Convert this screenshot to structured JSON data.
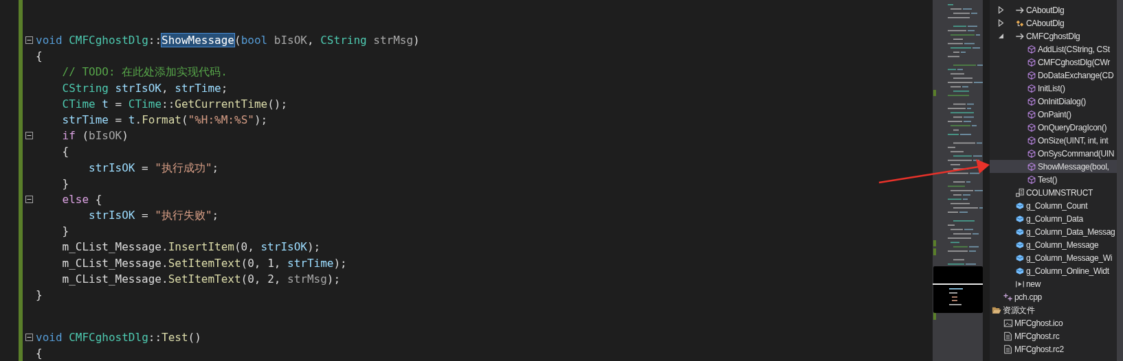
{
  "editor": {
    "lines": [
      {
        "kind": "top",
        "fold": true,
        "tokens": [
          {
            "kind": "keyword",
            "text": "void "
          },
          {
            "kind": "type",
            "text": "CMFCghostDlg"
          },
          {
            "kind": "plain",
            "text": "::"
          },
          {
            "kind": "selection",
            "text": "ShowMessage"
          },
          {
            "kind": "plain",
            "text": "("
          },
          {
            "kind": "keyword",
            "text": "bool"
          },
          {
            "kind": "param",
            "text": " bIsOK"
          },
          {
            "kind": "plain",
            "text": ", "
          },
          {
            "kind": "type",
            "text": "CString"
          },
          {
            "kind": "param",
            "text": " strMsg"
          },
          {
            "kind": "plain",
            "text": ")"
          }
        ]
      },
      {
        "kind": "top",
        "fold": false,
        "tokens": [
          {
            "kind": "plain",
            "text": "{"
          }
        ]
      },
      {
        "kind": "body",
        "fold": false,
        "tokens": [
          {
            "kind": "comment",
            "text": "// TODO: 在此处添加实现代码."
          }
        ]
      },
      {
        "kind": "body",
        "fold": false,
        "tokens": [
          {
            "kind": "type",
            "text": "CString "
          },
          {
            "kind": "variable",
            "text": "strIsOK"
          },
          {
            "kind": "plain",
            "text": ", "
          },
          {
            "kind": "variable",
            "text": "strTime"
          },
          {
            "kind": "plain",
            "text": ";"
          }
        ]
      },
      {
        "kind": "body",
        "fold": false,
        "tokens": [
          {
            "kind": "type",
            "text": "CTime "
          },
          {
            "kind": "variable",
            "text": "t"
          },
          {
            "kind": "plain",
            "text": " = "
          },
          {
            "kind": "type",
            "text": "CTime"
          },
          {
            "kind": "plain",
            "text": "::"
          },
          {
            "kind": "function",
            "text": "GetCurrentTime"
          },
          {
            "kind": "plain",
            "text": "();"
          }
        ]
      },
      {
        "kind": "body",
        "fold": false,
        "tokens": [
          {
            "kind": "variable",
            "text": "strTime"
          },
          {
            "kind": "plain",
            "text": " = "
          },
          {
            "kind": "variable",
            "text": "t"
          },
          {
            "kind": "plain",
            "text": "."
          },
          {
            "kind": "function",
            "text": "Format"
          },
          {
            "kind": "plain",
            "text": "("
          },
          {
            "kind": "string",
            "text": "\"%H:%M:%S\""
          },
          {
            "kind": "plain",
            "text": ");"
          }
        ]
      },
      {
        "kind": "body",
        "fold": true,
        "tokens": [
          {
            "kind": "control",
            "text": "if"
          },
          {
            "kind": "plain",
            "text": " ("
          },
          {
            "kind": "param",
            "text": "bIsOK"
          },
          {
            "kind": "plain",
            "text": ")"
          }
        ]
      },
      {
        "kind": "body",
        "fold": false,
        "tokens": [
          {
            "kind": "plain",
            "text": "{"
          }
        ]
      },
      {
        "kind": "inner",
        "fold": false,
        "tokens": [
          {
            "kind": "variable",
            "text": "strIsOK"
          },
          {
            "kind": "plain",
            "text": " = "
          },
          {
            "kind": "string",
            "text": "\"执行成功\""
          },
          {
            "kind": "plain",
            "text": ";"
          }
        ]
      },
      {
        "kind": "body",
        "fold": false,
        "tokens": [
          {
            "kind": "plain",
            "text": "}"
          }
        ]
      },
      {
        "kind": "body",
        "fold": true,
        "tokens": [
          {
            "kind": "control",
            "text": "else"
          },
          {
            "kind": "plain",
            "text": " {"
          }
        ]
      },
      {
        "kind": "inner",
        "fold": false,
        "tokens": [
          {
            "kind": "variable",
            "text": "strIsOK"
          },
          {
            "kind": "plain",
            "text": " = "
          },
          {
            "kind": "string",
            "text": "\"执行失败\""
          },
          {
            "kind": "plain",
            "text": ";"
          }
        ]
      },
      {
        "kind": "body",
        "fold": false,
        "tokens": [
          {
            "kind": "plain",
            "text": "}"
          }
        ]
      },
      {
        "kind": "body",
        "fold": false,
        "tokens": [
          {
            "kind": "plain",
            "text": "m_CList_Message."
          },
          {
            "kind": "function",
            "text": "InsertItem"
          },
          {
            "kind": "plain",
            "text": "(0, "
          },
          {
            "kind": "variable",
            "text": "strIsOK"
          },
          {
            "kind": "plain",
            "text": ");"
          }
        ]
      },
      {
        "kind": "body",
        "fold": false,
        "tokens": [
          {
            "kind": "plain",
            "text": "m_CList_Message."
          },
          {
            "kind": "function",
            "text": "SetItemText"
          },
          {
            "kind": "plain",
            "text": "(0, 1, "
          },
          {
            "kind": "variable",
            "text": "strTime"
          },
          {
            "kind": "plain",
            "text": ");"
          }
        ]
      },
      {
        "kind": "body",
        "fold": false,
        "tokens": [
          {
            "kind": "plain",
            "text": "m_CList_Message."
          },
          {
            "kind": "function",
            "text": "SetItemText"
          },
          {
            "kind": "plain",
            "text": "(0, 2, "
          },
          {
            "kind": "param",
            "text": "strMsg"
          },
          {
            "kind": "plain",
            "text": ");"
          }
        ]
      },
      {
        "kind": "top",
        "fold": false,
        "tokens": [
          {
            "kind": "plain",
            "text": "}"
          }
        ]
      },
      {
        "fold": false
      },
      {
        "fold": false
      },
      {
        "kind": "top",
        "fold": true,
        "tokens": [
          {
            "kind": "keyword",
            "text": "void "
          },
          {
            "kind": "type",
            "text": "CMFCghostDlg"
          },
          {
            "kind": "plain",
            "text": "::"
          },
          {
            "kind": "function",
            "text": "Test"
          },
          {
            "kind": "plain",
            "text": "()"
          }
        ]
      },
      {
        "kind": "top",
        "fold": false,
        "tokens": [
          {
            "kind": "plain",
            "text": "{"
          }
        ]
      }
    ]
  },
  "solution_explorer": {
    "class_rows": [
      {
        "label": "CAboutDlg",
        "kind": "class-ref",
        "selected": false,
        "expanded": false
      },
      {
        "label": "CAboutDlg",
        "kind": "class",
        "selected": false,
        "expanded": false
      },
      {
        "label": "CMFCghostDlg",
        "kind": "class-ref",
        "selected": false,
        "expanded": true,
        "children": [
          {
            "label": "AddList(CString, CSt",
            "kind": "method",
            "selected": false
          },
          {
            "label": "CMFCghostDlg(CWr",
            "kind": "method",
            "selected": false
          },
          {
            "label": "DoDataExchange(CD",
            "kind": "method",
            "selected": false
          },
          {
            "label": "InitList()",
            "kind": "method",
            "selected": false
          },
          {
            "label": "OnInitDialog()",
            "kind": "method",
            "selected": false
          },
          {
            "label": "OnPaint()",
            "kind": "method",
            "selected": false
          },
          {
            "label": "OnQueryDragIcon()",
            "kind": "method",
            "selected": false
          },
          {
            "label": "OnSize(UINT, int, int",
            "kind": "method",
            "selected": false
          },
          {
            "label": "OnSysCommand(UIN",
            "kind": "method",
            "selected": false
          },
          {
            "label": "ShowMessage(bool,",
            "kind": "method",
            "selected": true
          },
          {
            "label": "Test()",
            "kind": "method",
            "selected": false
          }
        ]
      },
      {
        "label": "COLUMNSTRUCT",
        "kind": "struct",
        "selected": false
      },
      {
        "label": "g_Column_Count",
        "kind": "variable",
        "selected": false
      },
      {
        "label": "g_Column_Data",
        "kind": "variable",
        "selected": false
      },
      {
        "label": "g_Column_Data_Messag",
        "kind": "variable",
        "selected": false
      },
      {
        "label": "g_Column_Message",
        "kind": "variable",
        "selected": false
      },
      {
        "label": "g_Column_Message_Wi",
        "kind": "variable",
        "selected": false
      },
      {
        "label": "g_Column_Online_Widt",
        "kind": "variable",
        "selected": false
      },
      {
        "label": "new",
        "kind": "macro",
        "selected": false
      }
    ],
    "file_rows": [
      {
        "label": "pch.cpp",
        "kind": "cpp-file",
        "selected": false
      }
    ],
    "folder_rows": [
      {
        "label": "资源文件",
        "kind": "folder",
        "selected": false,
        "children": [
          {
            "label": "MFCghost.ico",
            "kind": "image-file",
            "selected": false
          },
          {
            "label": "MFCghost.rc",
            "kind": "resource-file",
            "selected": false
          },
          {
            "label": "MFCghost.rc2",
            "kind": "resource-file",
            "selected": false
          }
        ]
      }
    ]
  }
}
